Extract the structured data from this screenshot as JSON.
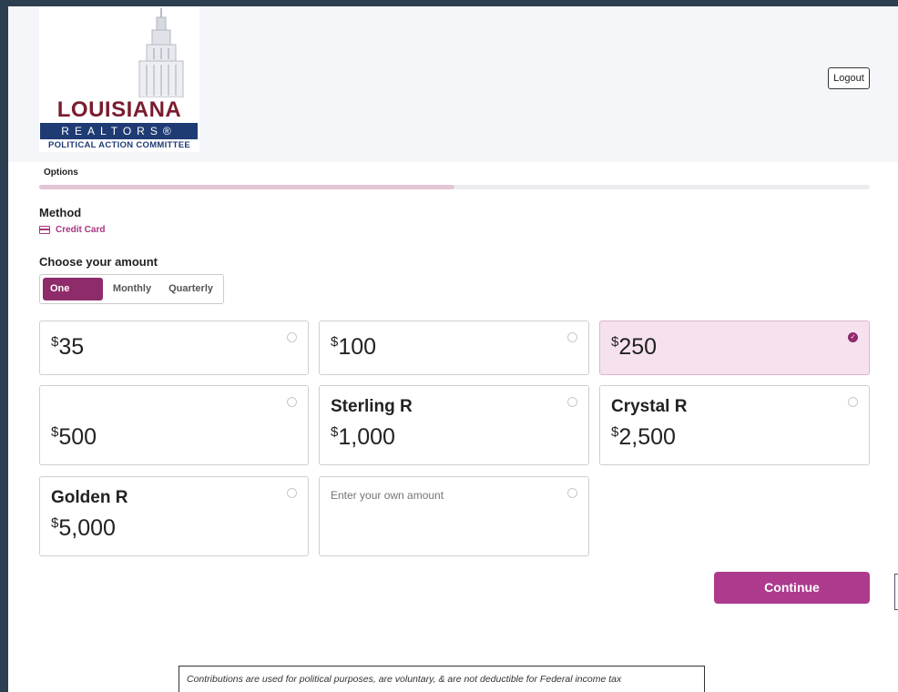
{
  "header": {
    "logo": {
      "main": "LOUISIANA",
      "bar": "REALTORS®",
      "sub": "POLITICAL ACTION COMMITTEE"
    },
    "logout_label": "Logout"
  },
  "progress": {
    "step_label": "Options",
    "percent": 50
  },
  "method": {
    "title": "Method",
    "selected": "Credit Card",
    "icon": "credit-card-icon"
  },
  "amount": {
    "title": "Choose your amount",
    "frequency": [
      {
        "label": "One Time",
        "active": true
      },
      {
        "label": "Monthly",
        "active": false
      },
      {
        "label": "Quarterly",
        "active": false
      }
    ],
    "options": [
      {
        "name": "",
        "currency": "$",
        "amount": "35",
        "selected": false
      },
      {
        "name": "",
        "currency": "$",
        "amount": "100",
        "selected": false
      },
      {
        "name": "",
        "currency": "$",
        "amount": "250",
        "selected": true
      },
      {
        "name": "",
        "currency": "$",
        "amount": "500",
        "selected": false
      },
      {
        "name": "Sterling R",
        "currency": "$",
        "amount": "1,000",
        "selected": false
      },
      {
        "name": "Crystal R",
        "currency": "$",
        "amount": "2,500",
        "selected": false
      },
      {
        "name": "Golden R",
        "currency": "$",
        "amount": "5,000",
        "selected": false
      }
    ],
    "custom_placeholder": "Enter your own amount"
  },
  "continue_label": "Continue",
  "disclaimer": "Contributions are used for political purposes, are voluntary, & are not deductible for Federal income tax",
  "colors": {
    "accent": "#8e2b6b",
    "button": "#ad3a8d",
    "selected_bg": "#f6e2ef",
    "logo_red": "#7a1d2e",
    "logo_blue": "#1f3b74"
  }
}
